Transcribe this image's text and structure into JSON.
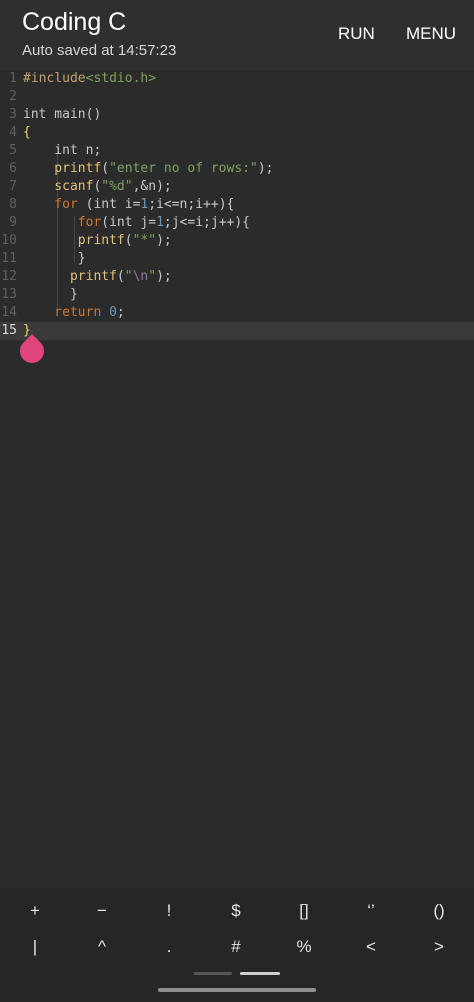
{
  "appbar": {
    "title": "Coding C",
    "subtitle": "Auto saved at 14:57:23",
    "run_label": "RUN",
    "menu_label": "MENU"
  },
  "editor": {
    "current_line": 15,
    "lines": [
      {
        "number": "1",
        "tokens": [
          {
            "t": "#include",
            "c": "pre"
          },
          {
            "t": "<stdio.h>",
            "c": "inc"
          }
        ]
      },
      {
        "number": "2",
        "tokens": []
      },
      {
        "number": "3",
        "tokens": [
          {
            "t": "int main",
            "c": "plain"
          },
          {
            "t": "()",
            "c": "plain"
          }
        ]
      },
      {
        "number": "4",
        "tokens": [
          {
            "t": "{",
            "c": "brace"
          }
        ]
      },
      {
        "number": "5",
        "tokens": [
          {
            "t": "    int n;",
            "c": "plain"
          }
        ]
      },
      {
        "number": "6",
        "tokens": [
          {
            "t": "    printf",
            "c": "fn"
          },
          {
            "t": "(",
            "c": "plain"
          },
          {
            "t": "\"enter no of rows:\"",
            "c": "str"
          },
          {
            "t": ");",
            "c": "plain"
          }
        ]
      },
      {
        "number": "7",
        "tokens": [
          {
            "t": "    scanf",
            "c": "fn"
          },
          {
            "t": "(",
            "c": "plain"
          },
          {
            "t": "\"%d\"",
            "c": "str"
          },
          {
            "t": ",&n);",
            "c": "plain"
          }
        ]
      },
      {
        "number": "8",
        "tokens": [
          {
            "t": "    for",
            "c": "kw"
          },
          {
            "t": " (int i=",
            "c": "plain"
          },
          {
            "t": "1",
            "c": "num"
          },
          {
            "t": ";i<=n;i++){",
            "c": "plain"
          }
        ]
      },
      {
        "number": "9",
        "tokens": [
          {
            "t": "       for",
            "c": "kw"
          },
          {
            "t": "(int j=",
            "c": "plain"
          },
          {
            "t": "1",
            "c": "num"
          },
          {
            "t": ";j<=i;j++){",
            "c": "plain"
          }
        ]
      },
      {
        "number": "10",
        "tokens": [
          {
            "t": "       printf",
            "c": "fn"
          },
          {
            "t": "(",
            "c": "plain"
          },
          {
            "t": "\"*\"",
            "c": "str"
          },
          {
            "t": ");",
            "c": "plain"
          }
        ]
      },
      {
        "number": "11",
        "tokens": [
          {
            "t": "       }",
            "c": "plain"
          }
        ]
      },
      {
        "number": "12",
        "tokens": [
          {
            "t": "      printf",
            "c": "fn"
          },
          {
            "t": "(",
            "c": "plain"
          },
          {
            "t": "\"",
            "c": "str"
          },
          {
            "t": "\\n",
            "c": "esc"
          },
          {
            "t": "\"",
            "c": "str"
          },
          {
            "t": ");",
            "c": "plain"
          }
        ]
      },
      {
        "number": "13",
        "tokens": [
          {
            "t": "      }",
            "c": "plain"
          }
        ]
      },
      {
        "number": "14",
        "tokens": [
          {
            "t": "    return ",
            "c": "kw"
          },
          {
            "t": "0",
            "c": "num"
          },
          {
            "t": ";",
            "c": "plain"
          }
        ]
      },
      {
        "number": "15",
        "tokens": [
          {
            "t": "}",
            "c": "brace"
          }
        ]
      }
    ]
  },
  "symbols": {
    "row1": [
      "+",
      "−",
      "!",
      "$",
      "[]",
      "‘’",
      "()"
    ],
    "row2": [
      "|",
      "^",
      ".",
      "#",
      "%",
      "<",
      ">"
    ]
  }
}
